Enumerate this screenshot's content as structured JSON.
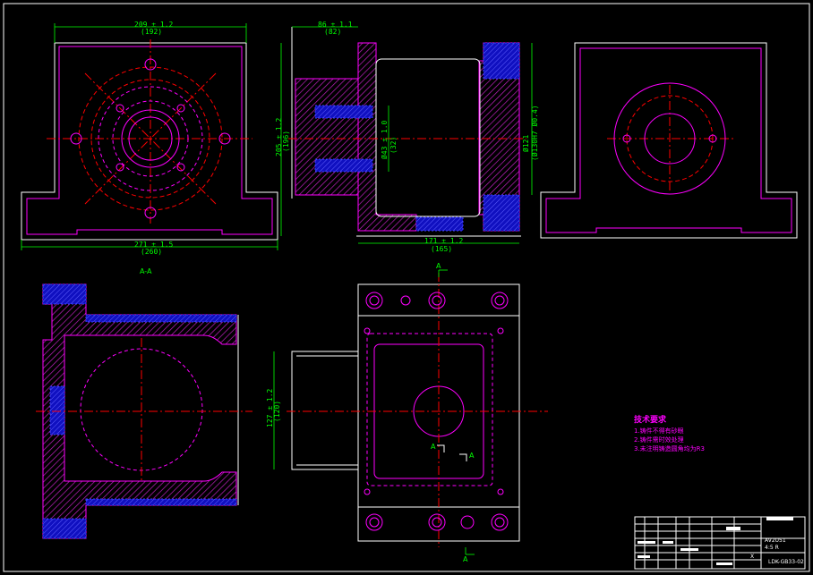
{
  "colors": {
    "background": "#000000",
    "outline": "#ffffff",
    "hidden": "#ff00ff",
    "center": "#ff0000",
    "dimension": "#00ff00",
    "highlight": "#3333ff"
  },
  "views": {
    "front": {
      "width_dim": "209 ± 1.2",
      "width_ref": "(192)",
      "base_dim": "271 ± 1.5",
      "base_ref": "(260)"
    },
    "side": {
      "top_dim": "86 ± 1.1",
      "top_ref": "(82)",
      "height_dim": "205 ± 1.2",
      "height_ref": "(196)",
      "bore_dim": "Ø43 ± 1.0",
      "bore_ref": "(32)",
      "dia_dim": "Ø121",
      "dia_ref": "(Ø130H7 Ø0.4)",
      "bottom_dim": "171 ± 1.2",
      "bottom_ref": "(165)"
    },
    "section": {
      "label": "A-A"
    },
    "plan": {
      "height_dim": "127 ± 1.2",
      "height_ref": "(120)",
      "cut_mark_top": "A",
      "cut_mark_bottom": "A",
      "cut_mark_left": "A",
      "cut_mark_right": "A"
    }
  },
  "notes": {
    "title": "技术要求",
    "items": [
      "1.铸件不得有砂眼",
      "2.铸件需时效处理",
      "3.未注明铸造圆角均为R3"
    ]
  },
  "title_block": {
    "material": "AV2U51",
    "scale": "4:5 R",
    "drawing_no": "LDK-GB33-02",
    "mark": "X"
  }
}
